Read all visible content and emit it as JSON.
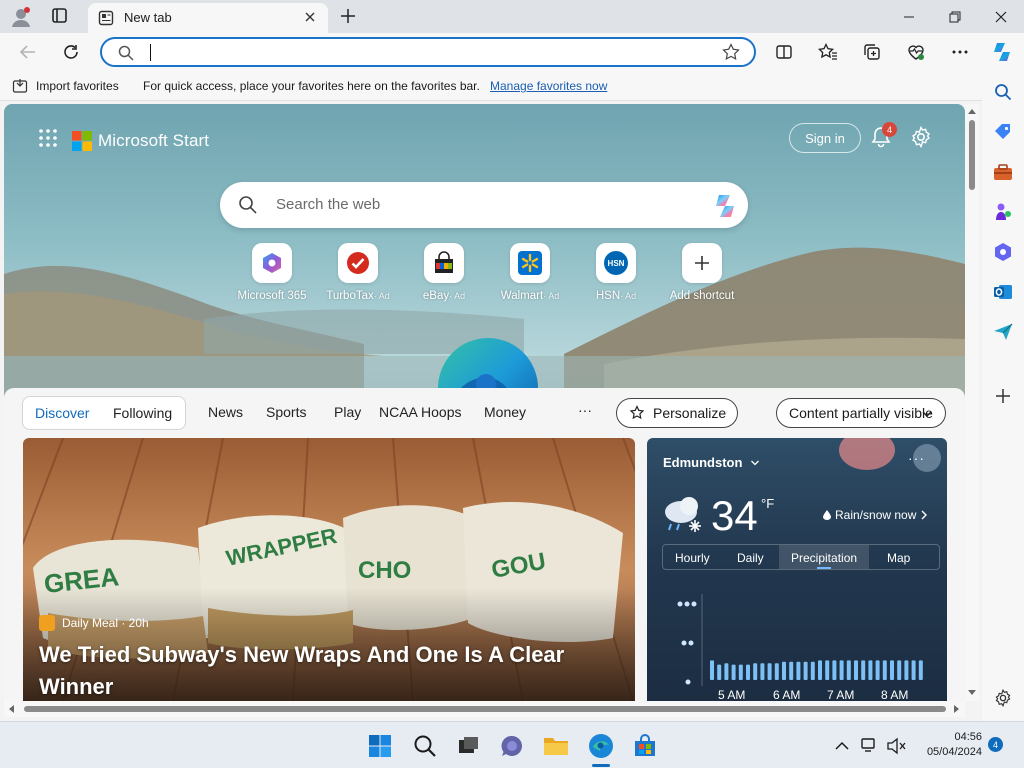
{
  "tab": {
    "title": "New tab"
  },
  "toolbar": {
    "address_value": ""
  },
  "favorites_bar": {
    "import_label": "Import favorites",
    "hint": "For quick access, place your favorites here on the favorites bar.",
    "manage_link": "Manage favorites now"
  },
  "start": {
    "brand": "Microsoft Start",
    "sign_in": "Sign in",
    "notification_count": "4",
    "search_placeholder": "Search the web",
    "shortcuts": [
      {
        "label": "Microsoft 365",
        "ad": "",
        "icon": "microsoft-365-icon"
      },
      {
        "label": "TurboTax",
        "ad": "· Ad",
        "icon": "turbotax-icon"
      },
      {
        "label": "eBay",
        "ad": "· Ad",
        "icon": "ebay-icon"
      },
      {
        "label": "Walmart",
        "ad": "· Ad",
        "icon": "walmart-icon"
      },
      {
        "label": "HSN",
        "ad": "· Ad",
        "icon": "hsn-icon"
      },
      {
        "label": "Add shortcut",
        "ad": "",
        "icon": "plus-icon"
      }
    ]
  },
  "feed": {
    "segments": [
      "Discover",
      "Following"
    ],
    "active_segment": "Discover",
    "tabs": [
      "News",
      "Sports",
      "Play",
      "NCAA Hoops",
      "Money"
    ],
    "more": "···",
    "personalize": "Personalize",
    "visibility": "Content partially visible"
  },
  "hero": {
    "source": "Daily Meal · 20h",
    "headline": "We Tried Subway's New Wraps And One Is A Clear Winner",
    "wrapper_words": [
      "GREA",
      "WRAPPER",
      "CHO",
      "GOU"
    ]
  },
  "hsn_logo_text": "HSN",
  "weather": {
    "location": "Edmundston",
    "more": "···",
    "temperature": "34",
    "unit": "°F",
    "condition": "Rain/snow now",
    "tabs": [
      "Hourly",
      "Daily",
      "Precipitation",
      "Map"
    ],
    "selected_tab": "Precipitation",
    "time_labels": [
      "5 AM",
      "6 AM",
      "7 AM",
      "8 AM"
    ],
    "precip_bars": [
      0.7,
      0.55,
      0.6,
      0.55,
      0.55,
      0.55,
      0.6,
      0.6,
      0.6,
      0.6,
      0.65,
      0.65,
      0.65,
      0.65,
      0.65,
      0.7,
      0.7,
      0.7,
      0.7,
      0.7,
      0.7,
      0.7,
      0.7,
      0.7,
      0.7,
      0.7,
      0.7,
      0.7,
      0.7,
      0.7
    ]
  },
  "taskbar": {
    "time": "04:56",
    "date": "05/04/2024",
    "notification_count": "4"
  },
  "colors": {
    "accent": "#0f6cbd",
    "address_border": "#1a73c9",
    "badge": "#d9473a"
  }
}
